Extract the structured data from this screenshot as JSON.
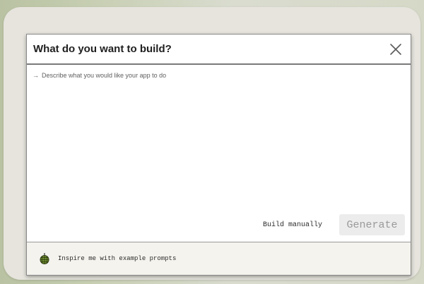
{
  "dialog": {
    "title": "What do you want to build?",
    "close_icon": "close-icon",
    "prompt_arrow": "→",
    "prompt_placeholder": "Describe what you would like your app to do",
    "build_manually_label": "Build manually",
    "generate_label": "Generate",
    "inspire_label": "Inspire me with example prompts",
    "inspire_icon": "disco-ball-icon"
  },
  "colors": {
    "dialog_background": "#ffffff",
    "generate_background": "#ececec",
    "generate_text": "#9a9a9a",
    "footer_background": "#f4f3ee"
  }
}
